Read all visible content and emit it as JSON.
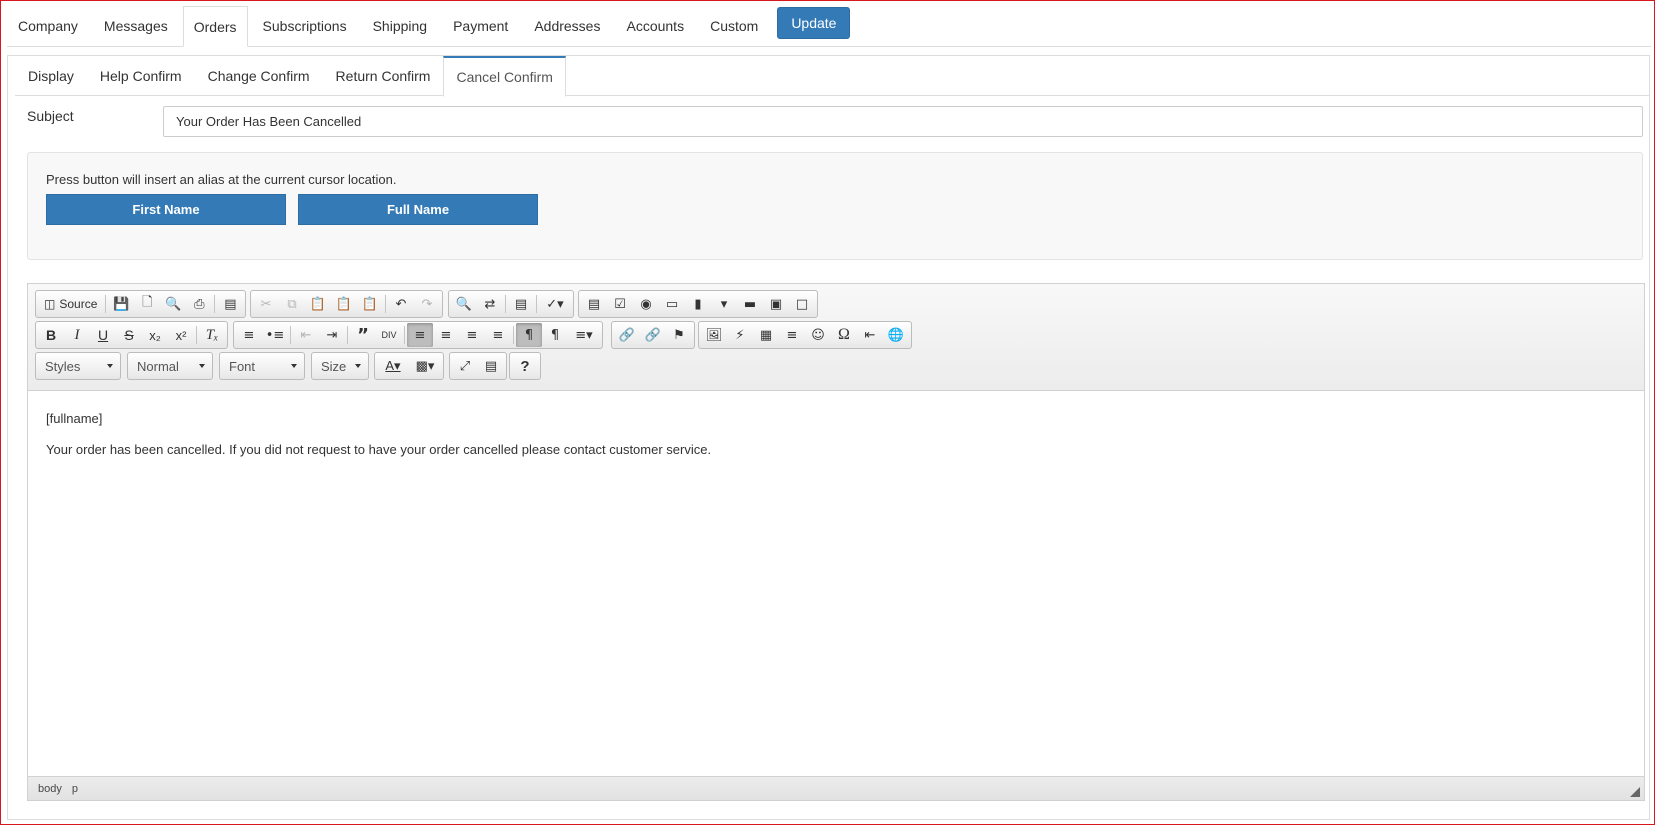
{
  "top_tabs": [
    {
      "label": "Company"
    },
    {
      "label": "Messages"
    },
    {
      "label": "Orders"
    },
    {
      "label": "Subscriptions"
    },
    {
      "label": "Shipping"
    },
    {
      "label": "Payment"
    },
    {
      "label": "Addresses"
    },
    {
      "label": "Accounts"
    },
    {
      "label": "Custom"
    }
  ],
  "active_top_tab": "Orders",
  "update_label": "Update",
  "sub_tabs": [
    {
      "label": "Display"
    },
    {
      "label": "Help Confirm"
    },
    {
      "label": "Change Confirm"
    },
    {
      "label": "Return Confirm"
    },
    {
      "label": "Cancel Confirm"
    }
  ],
  "active_sub_tab": "Cancel Confirm",
  "subject": {
    "label": "Subject",
    "value": "Your Order Has Been Cancelled"
  },
  "alias": {
    "instruction": "Press button will insert an alias at the current cursor location.",
    "buttons": [
      "First Name",
      "Full Name"
    ]
  },
  "editor": {
    "source_label": "Source",
    "combos": {
      "styles": "Styles",
      "format": "Normal",
      "font": "Font",
      "size": "Size"
    },
    "content": {
      "line1": "[fullname]",
      "line2": "Your order has been cancelled. If you did not request to have your order cancelled please contact customer service."
    },
    "path": [
      "body",
      "p"
    ]
  },
  "colors": {
    "primary": "#337ab7",
    "frame": "#d9171e"
  }
}
